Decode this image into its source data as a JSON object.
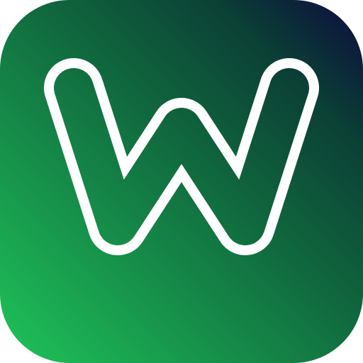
{
  "icon": {
    "name": "app-icon",
    "glyph": "W",
    "glyph_icon": "letter-w-outline-icon",
    "colors": {
      "gradient_bottom_left": "#1fc45a",
      "gradient_middle": "#10683e",
      "gradient_top_right": "#0c0a3e",
      "outline": "#ffffff"
    }
  }
}
